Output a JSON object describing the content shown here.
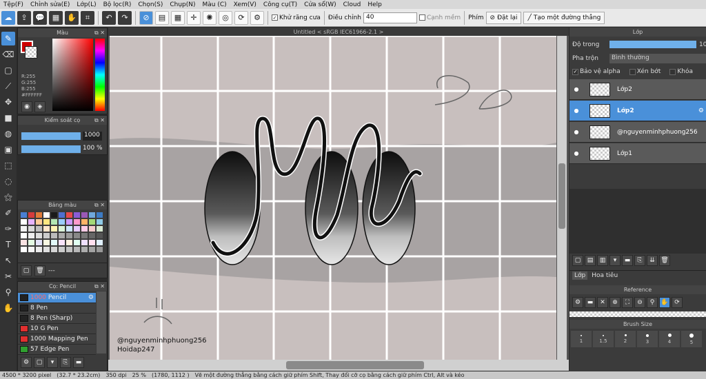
{
  "menu": [
    "Tệp(F)",
    "Chỉnh sửa(E)",
    "Lớp(L)",
    "Bộ lọc(R)",
    "Chọn(S)",
    "Chụp(N)",
    "Màu (C)",
    "Xem(V)",
    "Công cụ(T)",
    "Cửa sổ(W)",
    "Cloud",
    "Help"
  ],
  "toolbar": {
    "antialias_label": "Khử răng cưa",
    "adjust_label": "Điều chỉnh",
    "adjust_value": "40",
    "edge_label": "Cạnh mềm",
    "key_label": "Phím",
    "reset_label": "Đặt lại",
    "line_label": "Tạo một đường thẳng"
  },
  "color_panel": {
    "title": "Màu",
    "r": "R:255",
    "g": "G:255",
    "b": "B:255",
    "hex": "#FFFFFF"
  },
  "brush_control": {
    "title": "Kiểm soát cọ",
    "size": "1000",
    "opacity": "100 %"
  },
  "palette": {
    "title": "Bảng màu",
    "footer": "---",
    "colors": [
      "#4a7fd4",
      "#d43c3c",
      "#e07b39",
      "#ffffff",
      "#1a1a1a",
      "#4f6fcf",
      "#e64a4a",
      "#8a5cd6",
      "#9b59b6",
      "#6fa8dc",
      "#3c7bc4",
      "#ffffff",
      "#e6b3ff",
      "#ffcc99",
      "#ffe680",
      "#b3e6b3",
      "#99ccff",
      "#cc99ff",
      "#ff99cc",
      "#ffb366",
      "#a3d977",
      "#8ecae6",
      "#f2f2f2",
      "#d9d9d9",
      "#bfbfbf",
      "#ffe6cc",
      "#fff2b3",
      "#d9f2d9",
      "#cce6ff",
      "#e6ccff",
      "#ffcce6",
      "#f4cccc",
      "#d9ead3",
      "#ffffff",
      "#eeeeee",
      "#dddddd",
      "#cccccc",
      "#bbbbbb",
      "#aaaaaa",
      "#999999",
      "#888888",
      "#777777",
      "#666666",
      "#555555",
      "#f9e3e3",
      "#e3f9e3",
      "#e3e3f9",
      "#f9f9e3",
      "#e3f9f9",
      "#f9e3f9",
      "#fff0e0",
      "#e0fff0",
      "#f0e0ff",
      "#ffe0f0",
      "#e0f0ff",
      "#ffffff",
      "#f5f5f5",
      "#ebebeb",
      "#e0e0e0",
      "#d6d6d6",
      "#cccccc",
      "#c2c2c2",
      "#b8b8b8",
      "#adadad",
      "#a3a3a3",
      "#999999"
    ]
  },
  "brush_panel": {
    "title": "Cọ: Pencil",
    "brushes": [
      {
        "size": "1000",
        "name": "Pencil",
        "selected": true,
        "color": "#222222"
      },
      {
        "size": "8",
        "name": "Pen",
        "selected": false,
        "color": "#222222"
      },
      {
        "size": "8",
        "name": "Pen (Sharp)",
        "selected": false,
        "color": "#222222"
      },
      {
        "size": "10",
        "name": "G Pen",
        "selected": false,
        "color": "#e03030"
      },
      {
        "size": "1000",
        "name": "Mapping Pen",
        "selected": false,
        "color": "#e03030"
      },
      {
        "size": "57",
        "name": "Edge Pen",
        "selected": false,
        "color": "#30a030"
      }
    ]
  },
  "document": {
    "title": "Untitled < sRGB IEC61966-2.1 >",
    "watermark1": "@nguyenminhphuong256",
    "watermark2": "Hoidap247"
  },
  "layer_panel": {
    "title": "Lớp",
    "opacity_label": "Độ trong",
    "opacity_value": "10",
    "blend_label": "Pha trộn",
    "blend_value": "Bình thường",
    "protect_alpha": "Bảo vệ alpha",
    "clip": "Xén bớt",
    "lock": "Khóa",
    "layers": [
      {
        "name": "Lớp2",
        "selected": false
      },
      {
        "name": "Lớp2",
        "selected": true
      },
      {
        "name": "@nguyenminhphuong256",
        "selected": false
      },
      {
        "name": "Lớp1",
        "selected": false
      }
    ],
    "tab1": "Lớp",
    "tab2": "Hoa tiêu"
  },
  "reference": {
    "title": "Reference"
  },
  "brush_size": {
    "title": "Brush Size",
    "sizes": [
      "1",
      "1.5",
      "2",
      "3",
      "4",
      "5"
    ]
  },
  "status": {
    "dims": "4500 * 3200 pixel",
    "cm": "(32.7 * 23.2cm)",
    "dpi": "350 dpi",
    "zoom": "25 %",
    "coords": "(1780, 1112 )",
    "hint": "Vẽ một đường thẳng bằng cách giữ phím Shift, Thay đổi cỡ cọ bằng cách giữ phím Ctrl, Alt và kéo"
  }
}
